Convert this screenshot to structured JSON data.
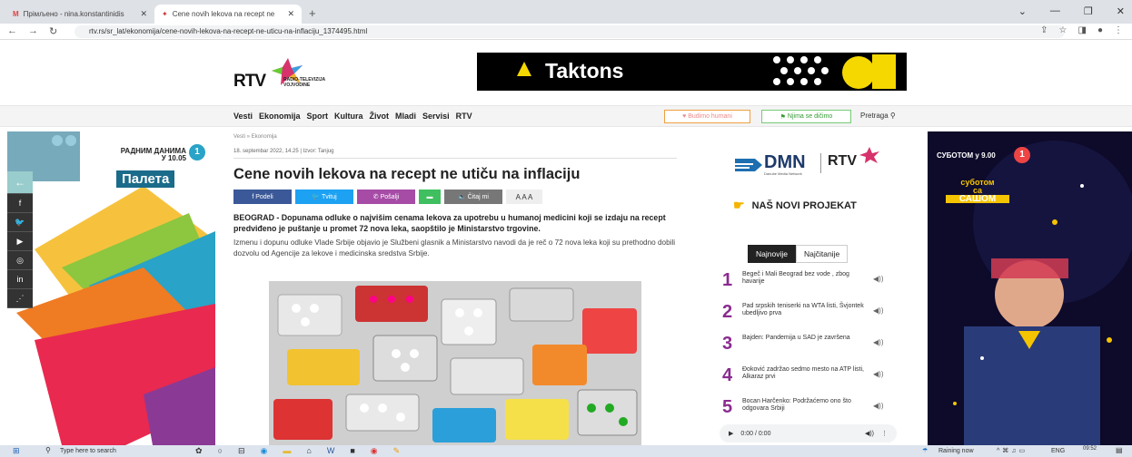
{
  "browser": {
    "tab1_title": "Прімљено - nina.konstantinidis",
    "tab2_title": "Cene novih lekova na recept ne",
    "url": "rtv.rs/sr_lat/ekonomija/cene-novih-lekova-na-recept-ne-uticu-na-inflaciju_1374495.html"
  },
  "site": {
    "logo": "RTV",
    "logo_sub": "RADIO-TELEVIZIJA VOJVODINE",
    "banner_text": "Taktons",
    "menu": [
      "Vesti",
      "Ekonomija",
      "Sport",
      "Kultura",
      "Život",
      "Mladi",
      "Servisi",
      "RTV"
    ],
    "btn_humani": "Budimo humani",
    "btn_njima": "Njima se dičimo",
    "search_label": "Pretraga"
  },
  "left_ad": {
    "line1": "РАДНИМ ДАНИМА",
    "line2": "У 10.05",
    "title": "Палета"
  },
  "article": {
    "breadcrumb": "Vesti » Ekonomija",
    "meta": "18. septembar 2022, 14.25 | Izvor: Tanjug",
    "title": "Cene novih lekova na recept ne utiču na inflaciju",
    "share": {
      "podeli": "Podeli",
      "tvituj": "Tvituj",
      "posalji": "Pošalji",
      "citaj": "Čitaj mi",
      "sizes": "A A A"
    },
    "lead": "BEOGRAD - Dopunama odluke o najvišim cenama lekova za upotrebu u humanoj medicini koji se izdaju na recept predviđeno je puštanje u promet 72 nova leka, saopštilo je Ministarstvo trgovine.",
    "body": "Izmenu i dopunu odluke Vlade Srbije objavio je Službeni glasnik a Ministarstvo navodi da je reč o 72 nova leka koji su prethodno dobili dozvolu od Agencije za lekove i medicinska sredstva Srbije."
  },
  "sidebar": {
    "dmn": "DMN",
    "dmn_sub": "Danube Media Network",
    "rtv": "RTV",
    "novi": "NAŠ NOVI PROJEKAT",
    "tab_new": "Najnovije",
    "tab_read": "Najčitanije",
    "news": [
      {
        "n": "1",
        "t": "Begeč i Mali Beograd bez vode , zbog havarije"
      },
      {
        "n": "2",
        "t": "Pad srpskih teniserki na WTA listi, Švjontek ubedljivo prva"
      },
      {
        "n": "3",
        "t": "Bajden: Pandemija u SAD je završena"
      },
      {
        "n": "4",
        "t": "Đoković zadržao sedmo mesto na ATP listi, Alkaraz prvi"
      },
      {
        "n": "5",
        "t": "Bocan Harčenko: Podržaćemo ono što odgovara Srbiji"
      }
    ],
    "audio_time": "0:00 / 0:00"
  },
  "right_ad": {
    "line1": "СУБОТОМ у 9.00",
    "line2": "суботом",
    "line3": "са",
    "line4": "САШОМ"
  },
  "taskbar": {
    "search": "Type here to search",
    "weather": "Raining now",
    "lang": "ENG",
    "time": "09:52"
  }
}
